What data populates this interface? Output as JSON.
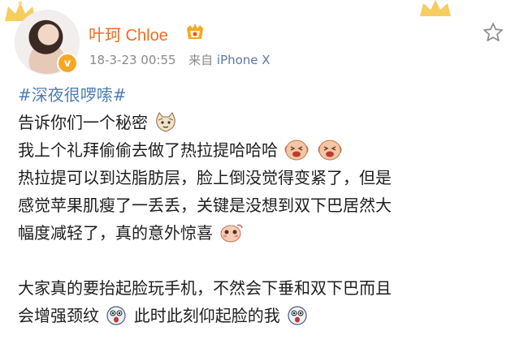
{
  "user": {
    "name": "叶珂 Chloe",
    "timestamp": "18-3-23 00:55",
    "source_prefix": "来自",
    "device": "iPhone X"
  },
  "post": {
    "hashtag": "#深夜很啰嗦#",
    "line1": "告诉你们一个秘密",
    "line2": "我上个礼拜偷偷去做了热拉提哈哈哈",
    "line3": "热拉提可以到达脂肪层，脸上倒没觉得变紧了，但是",
    "line4": "感觉苹果肌瘦了一丢丢，关键是没想到双下巴居然大",
    "line5": "幅度减轻了，真的意外惊喜",
    "line6": "大家真的要抬起脸玩手机，不然会下垂和双下巴而且",
    "line7a": "会增强颈纹",
    "line7b": "此时此刻仰起脸的我"
  },
  "icons": {
    "crown": "crown-icon",
    "verified": "verified-badge-icon",
    "vip": "vip-badge-icon",
    "star": "star-icon",
    "emoji_cat": "cat-emoji",
    "emoji_laugh": "laugh-emoji",
    "emoji_shy": "shy-emoji",
    "emoji_surprised": "surprised-emoji"
  },
  "colors": {
    "username": "#f36b21",
    "hashtag": "#4f7db3",
    "device": "#5b7aa3",
    "meta": "#8a8a8a",
    "text": "#1e1e1e"
  }
}
